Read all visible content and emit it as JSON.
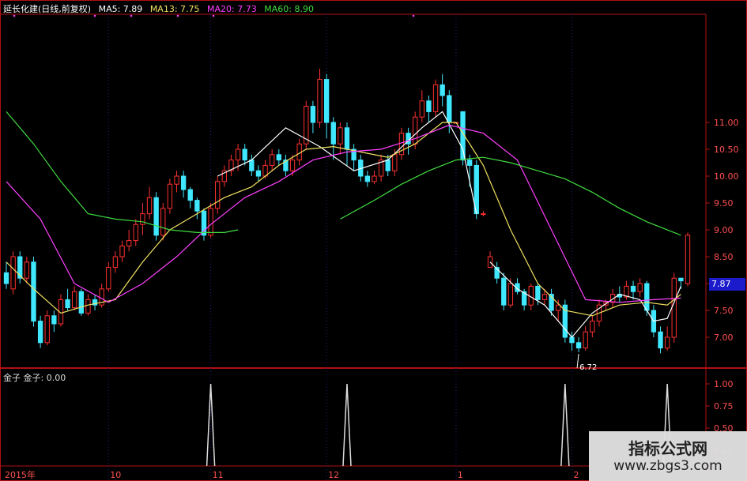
{
  "header": {
    "title": "延长化建(日线,前复权)",
    "ma5": {
      "label": "MA5: 7.89",
      "color": "#ffffff"
    },
    "ma13": {
      "label": "MA13: 7.75",
      "color": "#f0e060"
    },
    "ma20": {
      "label": "MA20: 7.73",
      "color": "#ff40ff"
    },
    "ma60": {
      "label": "MA60: 8.90",
      "color": "#40dd40"
    }
  },
  "sub_header": "金子  金子: 0.00",
  "last_price_tag": "7.87",
  "low_marker": "6.72",
  "watermark": {
    "title": "指标公式网",
    "url": "www.zbgs3.com"
  },
  "colors": {
    "up": "#ff3030",
    "down": "#40e8ff",
    "frame": "#b01010",
    "axis_text": "#ff5050"
  },
  "chart_data": {
    "type": "candlestick",
    "y_ticks": [
      "11.00",
      "10.50",
      "10.00",
      "9.50",
      "9.00",
      "8.50",
      "8.00",
      "7.50",
      "7.00"
    ],
    "sub_y_ticks": [
      "1.00",
      "0.75",
      "0.50",
      "0.25"
    ],
    "ylim": [
      6.6,
      12.2
    ],
    "x_month_labels": [
      {
        "label": "2015年",
        "index": 0
      },
      {
        "label": "10",
        "index": 15
      },
      {
        "label": "11",
        "index": 30
      },
      {
        "label": "12",
        "index": 47
      },
      {
        "label": "1",
        "index": 66
      },
      {
        "label": "2",
        "index": 83
      }
    ],
    "candles": [
      [
        8.2,
        8.0,
        8.4,
        7.9
      ],
      [
        7.9,
        8.5,
        8.6,
        7.8
      ],
      [
        8.5,
        8.1,
        8.6,
        8.0
      ],
      [
        8.1,
        8.4,
        8.5,
        8.0
      ],
      [
        8.4,
        7.3,
        8.5,
        7.2
      ],
      [
        7.3,
        6.9,
        7.4,
        6.8
      ],
      [
        6.9,
        7.4,
        7.5,
        6.85
      ],
      [
        7.4,
        7.25,
        7.5,
        7.1
      ],
      [
        7.25,
        7.7,
        7.8,
        7.2
      ],
      [
        7.7,
        7.55,
        7.9,
        7.5
      ],
      [
        7.55,
        7.85,
        7.95,
        7.5
      ],
      [
        7.85,
        7.45,
        7.9,
        7.4
      ],
      [
        7.45,
        7.7,
        7.8,
        7.4
      ],
      [
        7.7,
        7.6,
        7.8,
        7.5
      ],
      [
        7.6,
        7.9,
        8.0,
        7.55
      ],
      [
        7.9,
        8.3,
        8.4,
        7.85
      ],
      [
        8.3,
        8.5,
        8.6,
        8.2
      ],
      [
        8.5,
        8.7,
        8.8,
        8.4
      ],
      [
        8.7,
        8.8,
        9.0,
        8.6
      ],
      [
        8.8,
        9.1,
        9.2,
        8.7
      ],
      [
        9.1,
        9.3,
        9.5,
        8.9
      ],
      [
        9.3,
        9.6,
        9.8,
        9.2
      ],
      [
        9.6,
        8.9,
        9.7,
        8.8
      ],
      [
        8.9,
        9.4,
        9.5,
        8.8
      ],
      [
        9.4,
        9.85,
        9.95,
        9.3
      ],
      [
        9.85,
        10.0,
        10.1,
        9.7
      ],
      [
        10.0,
        9.75,
        10.1,
        9.6
      ],
      [
        9.75,
        9.55,
        9.8,
        9.4
      ],
      [
        9.55,
        9.35,
        9.6,
        9.2
      ],
      [
        9.35,
        8.9,
        9.4,
        8.8
      ],
      [
        8.9,
        9.4,
        9.5,
        8.85
      ],
      [
        9.4,
        9.9,
        10.0,
        9.3
      ],
      [
        9.9,
        10.1,
        10.2,
        9.8
      ],
      [
        10.1,
        10.3,
        10.4,
        10.0
      ],
      [
        10.3,
        10.5,
        10.6,
        10.1
      ],
      [
        10.5,
        10.3,
        10.6,
        10.2
      ],
      [
        10.3,
        10.1,
        10.4,
        10.0
      ],
      [
        10.1,
        10.0,
        10.2,
        9.9
      ],
      [
        10.0,
        10.2,
        10.3,
        9.95
      ],
      [
        10.2,
        10.4,
        10.5,
        10.1
      ],
      [
        10.4,
        10.3,
        10.5,
        10.2
      ],
      [
        10.3,
        10.1,
        10.4,
        10.0
      ],
      [
        10.1,
        10.3,
        10.4,
        10.0
      ],
      [
        10.3,
        10.6,
        10.7,
        10.2
      ],
      [
        10.6,
        11.3,
        11.4,
        10.5
      ],
      [
        11.3,
        11.0,
        11.4,
        10.8
      ],
      [
        11.0,
        11.8,
        12.0,
        10.9
      ],
      [
        11.8,
        11.0,
        11.9,
        10.7
      ],
      [
        11.0,
        10.6,
        11.1,
        10.3
      ],
      [
        10.6,
        10.9,
        11.0,
        10.4
      ],
      [
        10.9,
        10.5,
        11.0,
        10.2
      ],
      [
        10.5,
        10.3,
        10.6,
        10.1
      ],
      [
        10.3,
        10.0,
        10.4,
        9.9
      ],
      [
        10.0,
        9.9,
        10.1,
        9.8
      ],
      [
        9.9,
        10.0,
        10.1,
        9.85
      ],
      [
        10.0,
        10.3,
        10.4,
        9.9
      ],
      [
        10.3,
        10.1,
        10.4,
        10.0
      ],
      [
        10.1,
        10.4,
        10.5,
        10.0
      ],
      [
        10.4,
        10.8,
        10.9,
        10.3
      ],
      [
        10.8,
        10.6,
        10.9,
        10.4
      ],
      [
        10.6,
        11.1,
        11.2,
        10.5
      ],
      [
        11.1,
        11.4,
        11.6,
        11.0
      ],
      [
        11.4,
        11.2,
        11.5,
        11.0
      ],
      [
        11.2,
        11.7,
        11.8,
        11.1
      ],
      [
        11.7,
        11.5,
        11.9,
        11.3
      ],
      [
        11.5,
        11.0,
        11.6,
        10.8
      ],
      [
        11.0,
        11.0,
        11.0,
        11.0
      ],
      [
        11.2,
        10.3,
        11.2,
        10.2
      ],
      [
        10.3,
        10.2,
        10.4,
        9.8
      ],
      [
        10.2,
        9.3,
        10.3,
        9.2
      ],
      [
        9.3,
        9.3,
        9.35,
        9.25
      ],
      [
        8.3,
        8.5,
        8.6,
        8.3
      ],
      [
        8.3,
        8.1,
        8.4,
        8.0
      ],
      [
        8.1,
        7.6,
        8.2,
        7.5
      ],
      [
        7.6,
        8.0,
        8.1,
        7.55
      ],
      [
        8.0,
        7.85,
        8.1,
        7.8
      ],
      [
        7.85,
        7.6,
        7.9,
        7.5
      ],
      [
        7.6,
        7.95,
        8.0,
        7.5
      ],
      [
        7.95,
        7.7,
        8.0,
        7.6
      ],
      [
        7.7,
        7.8,
        7.9,
        7.6
      ],
      [
        7.8,
        7.5,
        7.9,
        7.4
      ],
      [
        7.5,
        7.6,
        7.7,
        7.3
      ],
      [
        7.6,
        7.0,
        7.7,
        6.9
      ],
      [
        7.0,
        6.9,
        7.1,
        6.75
      ],
      [
        6.9,
        6.8,
        7.0,
        6.72
      ],
      [
        6.8,
        7.1,
        7.2,
        6.75
      ],
      [
        7.1,
        7.3,
        7.4,
        7.0
      ],
      [
        7.3,
        7.6,
        7.7,
        7.2
      ],
      [
        7.6,
        7.65,
        7.7,
        7.5
      ],
      [
        7.65,
        7.8,
        7.9,
        7.55
      ],
      [
        7.8,
        7.75,
        7.95,
        7.65
      ],
      [
        7.75,
        7.95,
        8.05,
        7.7
      ],
      [
        7.95,
        7.85,
        8.05,
        7.7
      ],
      [
        7.85,
        8.0,
        8.1,
        7.75
      ],
      [
        8.0,
        7.5,
        8.05,
        7.4
      ],
      [
        7.5,
        7.1,
        7.6,
        7.0
      ],
      [
        7.1,
        6.8,
        7.2,
        6.7
      ],
      [
        6.8,
        7.0,
        7.2,
        6.75
      ],
      [
        7.0,
        8.1,
        8.2,
        6.9
      ],
      [
        8.1,
        8.05,
        8.1,
        7.9
      ],
      [
        8.0,
        8.9,
        8.95,
        7.95
      ]
    ],
    "ma_lines": [
      {
        "name": "MA5",
        "color": "#ffffff",
        "x": [
          31,
          36,
          41,
          46,
          51,
          56,
          61,
          64,
          67,
          69
        ],
        "y": [
          10.0,
          10.3,
          10.9,
          10.55,
          10.1,
          10.3,
          10.9,
          11.2,
          10.5,
          9.3
        ]
      },
      {
        "name": "MA5",
        "color": "#ffffff",
        "x": [
          71,
          75,
          79,
          83,
          86,
          90,
          93,
          95,
          97,
          99
        ],
        "y": [
          8.4,
          7.9,
          7.6,
          7.0,
          7.45,
          7.8,
          7.7,
          7.3,
          7.35,
          7.95
        ]
      },
      {
        "name": "MA13",
        "color": "#f0e060",
        "x": [
          0,
          4,
          8,
          12,
          16,
          20,
          24,
          28,
          32,
          36,
          40,
          44,
          48,
          52,
          56,
          60,
          64,
          66,
          70,
          74,
          78,
          82,
          86,
          90,
          94,
          97,
          99
        ],
        "y": [
          8.4,
          7.9,
          7.45,
          7.6,
          7.7,
          8.4,
          9.0,
          9.3,
          9.6,
          9.8,
          10.2,
          10.5,
          10.55,
          10.45,
          10.35,
          10.6,
          11.0,
          11.0,
          10.2,
          9.0,
          8.0,
          7.5,
          7.4,
          7.6,
          7.65,
          7.6,
          7.8
        ]
      },
      {
        "name": "MA20",
        "color": "#ff40ff",
        "x": [
          0,
          5,
          10,
          15,
          20,
          25,
          30,
          35,
          40,
          45,
          50,
          55,
          60,
          65,
          70,
          75,
          80,
          85,
          90,
          95,
          99
        ],
        "y": [
          9.9,
          9.2,
          8.0,
          7.65,
          8.0,
          8.5,
          9.1,
          9.6,
          9.9,
          10.3,
          10.45,
          10.5,
          10.7,
          10.95,
          10.8,
          10.3,
          9.0,
          7.7,
          7.65,
          7.7,
          7.73
        ]
      },
      {
        "name": "MA60",
        "color": "#40dd40",
        "x": [
          0,
          4,
          8,
          12,
          16,
          20,
          24,
          28,
          32,
          34
        ],
        "y": [
          11.2,
          10.6,
          9.9,
          9.3,
          9.2,
          9.15,
          9.0,
          8.95,
          8.95,
          9.0
        ]
      },
      {
        "name": "MA60",
        "color": "#40dd40",
        "x": [
          49,
          54,
          58,
          62,
          66,
          70,
          74,
          78,
          82,
          86,
          90,
          94,
          99
        ],
        "y": [
          9.2,
          9.55,
          9.85,
          10.1,
          10.3,
          10.35,
          10.25,
          10.1,
          9.95,
          9.7,
          9.4,
          9.15,
          8.9
        ]
      }
    ],
    "signal_spikes": [
      30,
      50,
      82,
      97
    ]
  }
}
